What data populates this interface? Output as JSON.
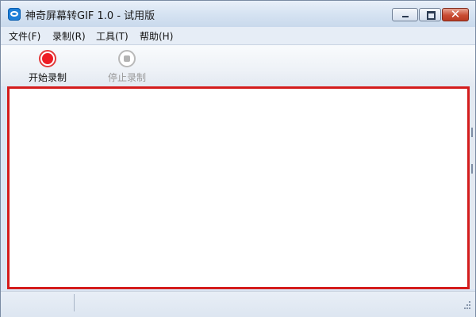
{
  "window": {
    "title": "神奇屏幕转GIF 1.0 - 试用版",
    "app_icon": "app-logo-icon",
    "controls": {
      "minimize": "minimize-icon",
      "maximize": "maximize-icon",
      "close_glyph": "✕"
    }
  },
  "menubar": {
    "items": [
      {
        "label": "文件(F)"
      },
      {
        "label": "录制(R)"
      },
      {
        "label": "工具(T)"
      },
      {
        "label": "帮助(H)"
      }
    ]
  },
  "toolbar": {
    "start": {
      "label": "开始录制",
      "icon": "record-icon",
      "enabled": true
    },
    "stop": {
      "label": "停止录制",
      "icon": "stop-icon",
      "enabled": false
    }
  },
  "capture_region": {
    "border_color": "#d41c1c"
  },
  "statusbar": {
    "pane1": "",
    "pane2": ""
  }
}
